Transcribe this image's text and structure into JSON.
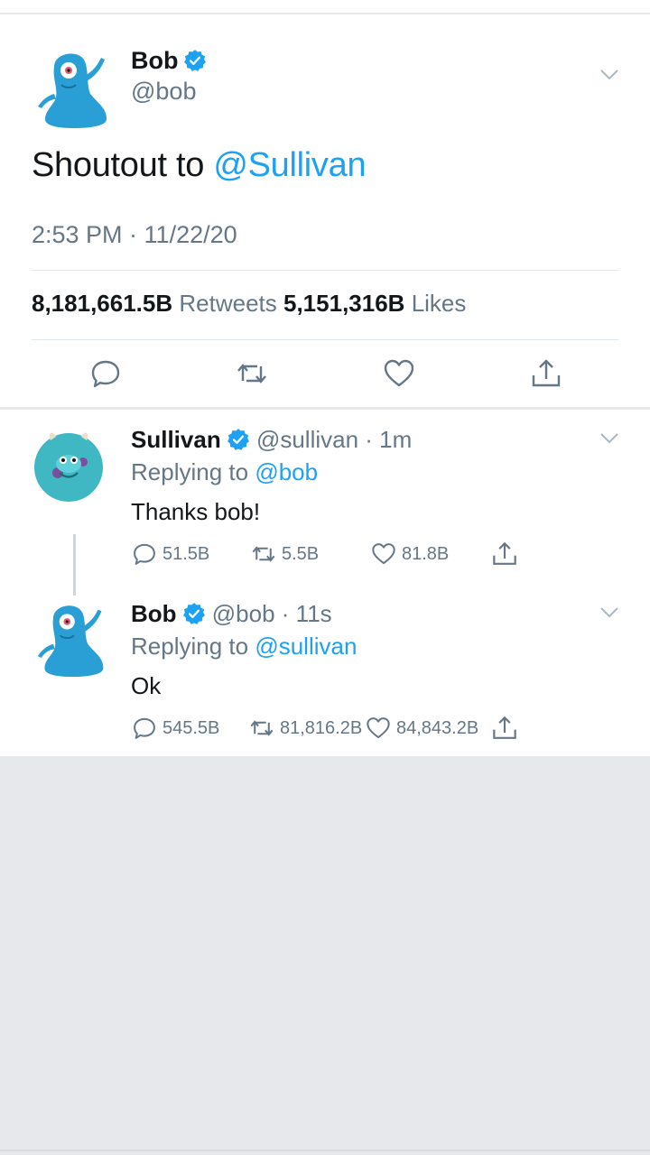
{
  "main_tweet": {
    "name": "Bob",
    "handle": "@bob",
    "text_plain": "Shoutout to ",
    "text_mention": "@Sullivan",
    "timestamp": "2:53 PM · 11/22/20",
    "retweets_count": "8,181,661.5B",
    "retweets_label": "Retweets",
    "likes_count": "5,151,316B",
    "likes_label": "Likes"
  },
  "replies": [
    {
      "name": "Sullivan",
      "handle": "@sullivan",
      "time": "· 1m",
      "replying_prefix": "Replying to ",
      "replying_handle": "@bob",
      "text": "Thanks bob!",
      "replies": "51.5B",
      "retweets": "5.5B",
      "likes": "81.8B"
    },
    {
      "name": "Bob",
      "handle": "@bob",
      "time": "· 11s",
      "replying_prefix": "Replying to ",
      "replying_handle": "@sullivan",
      "text": "Ok",
      "replies": "545.5B",
      "retweets": "81,816.2B",
      "likes": "84,843.2B"
    }
  ],
  "colors": {
    "accent": "#1da1f2",
    "muted": "#657786",
    "background": "#e6e8ec"
  },
  "icons": [
    "verified-badge-icon",
    "chevron-down-icon",
    "reply-icon",
    "retweet-icon",
    "like-icon",
    "share-icon"
  ]
}
